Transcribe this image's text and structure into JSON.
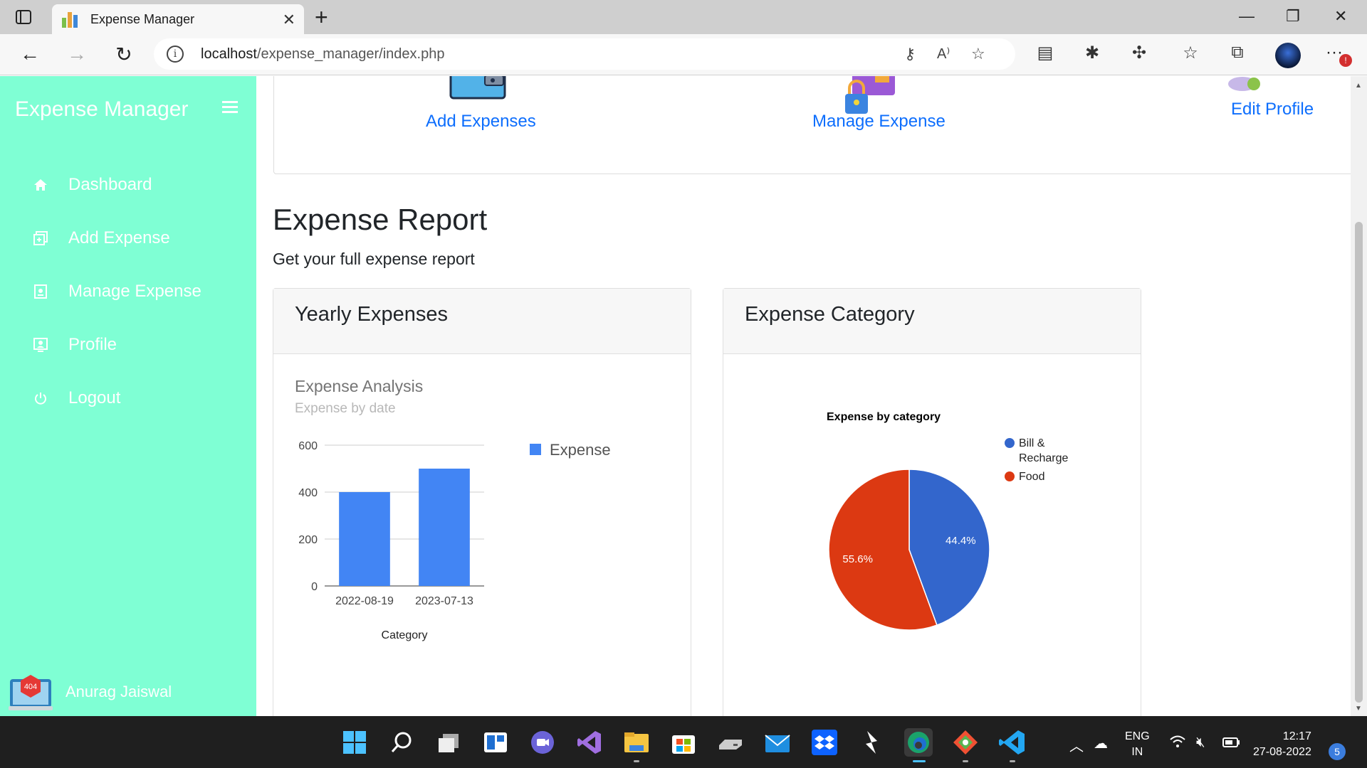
{
  "browser": {
    "tab_title": "Expense Manager",
    "url_host": "localhost",
    "url_path": "/expense_manager/index.php"
  },
  "sidebar": {
    "brand": "Expense Manager",
    "items": [
      {
        "label": "Dashboard",
        "icon": "home-icon"
      },
      {
        "label": "Add Expense",
        "icon": "add-expense-icon"
      },
      {
        "label": "Manage Expense",
        "icon": "manage-expense-icon"
      },
      {
        "label": "Profile",
        "icon": "profile-icon"
      },
      {
        "label": "Logout",
        "icon": "power-icon"
      }
    ],
    "username": "Anurag Jaiswal",
    "avatar_text": "404"
  },
  "quick_links": {
    "add": "Add Expenses",
    "manage": "Manage Expense",
    "edit": "Edit Profile"
  },
  "report": {
    "title": "Expense Report",
    "subtitle": "Get your full expense report"
  },
  "cards": {
    "yearly": "Yearly Expenses",
    "category": "Expense Category"
  },
  "chart_data": [
    {
      "type": "bar",
      "title": "Expense Analysis",
      "subtitle": "Expense by date",
      "categories": [
        "2022-08-19",
        "2023-07-13"
      ],
      "series": [
        {
          "name": "Expense",
          "values": [
            400,
            500
          ],
          "color": "#4285f4"
        }
      ],
      "xlabel": "Category",
      "ylabel": "",
      "ylim": [
        0,
        600
      ],
      "yticks": [
        0,
        200,
        400,
        600
      ],
      "legend": "right"
    },
    {
      "type": "pie",
      "title": "Expense by category",
      "slices": [
        {
          "label": "Bill & Recharge",
          "value": 44.4,
          "color": "#3366cc"
        },
        {
          "label": "Food",
          "value": 55.6,
          "color": "#dc3912"
        }
      ],
      "legend": "right"
    }
  ],
  "taskbar": {
    "lang_top": "ENG",
    "lang_bottom": "IN",
    "time": "12:17",
    "date": "27-08-2022",
    "notifications": "5"
  },
  "colors": {
    "sidebar": "#7fffd4",
    "link": "#0d6efd"
  }
}
